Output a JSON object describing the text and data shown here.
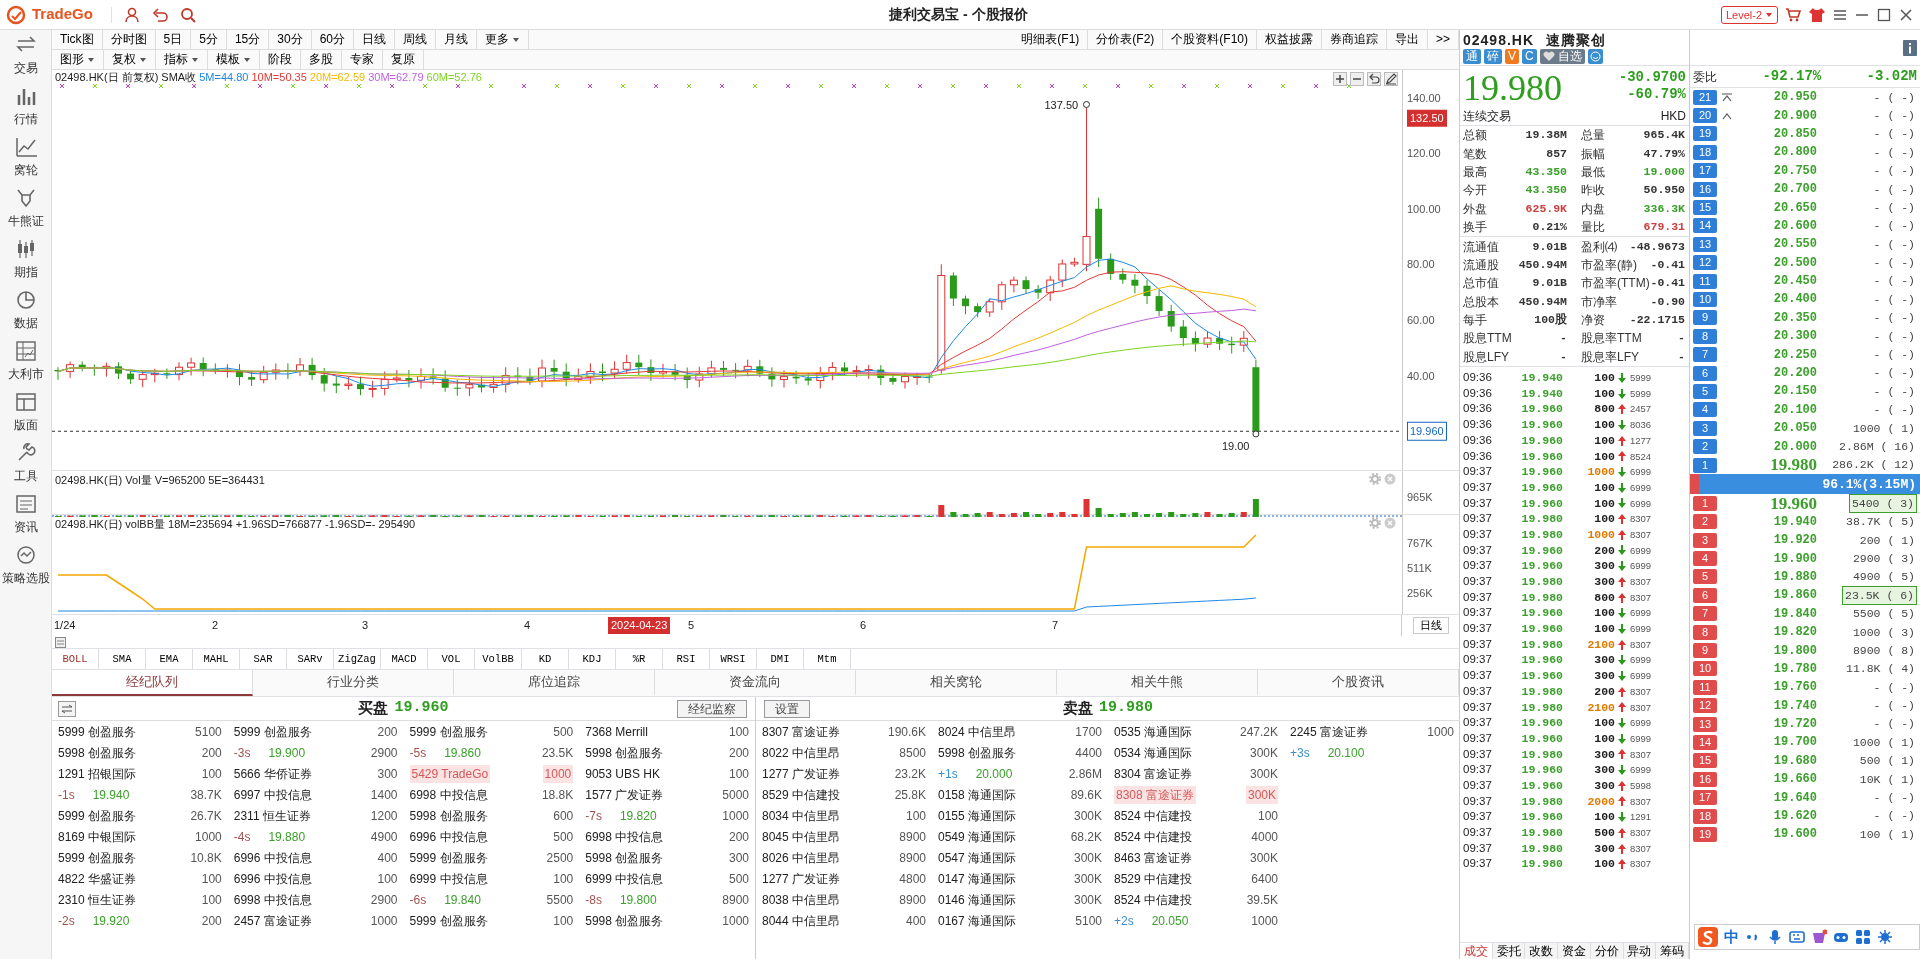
{
  "app": {
    "logo": "TradeGo",
    "title": "捷利交易宝 - 个股报价",
    "level_badge": "Level-2"
  },
  "sidebar": [
    {
      "label": "交易"
    },
    {
      "label": "行情"
    },
    {
      "label": "窝轮"
    },
    {
      "label": "牛熊证"
    },
    {
      "label": "期指"
    },
    {
      "label": "数据"
    },
    {
      "label": "大利市"
    },
    {
      "label": "版面"
    },
    {
      "label": "工具"
    },
    {
      "label": "资讯"
    },
    {
      "label": "策略选股"
    }
  ],
  "period_tabs": [
    {
      "label": "Tick图",
      "dropdown": false
    },
    {
      "label": "分时图",
      "dropdown": false
    },
    {
      "label": "5日",
      "dropdown": false
    },
    {
      "label": "5分",
      "dropdown": false
    },
    {
      "label": "15分",
      "dropdown": false
    },
    {
      "label": "30分",
      "dropdown": false
    },
    {
      "label": "60分",
      "dropdown": false
    },
    {
      "label": "日线",
      "dropdown": false
    },
    {
      "label": "周线",
      "dropdown": false
    },
    {
      "label": "月线",
      "dropdown": false
    },
    {
      "label": "更多",
      "dropdown": true
    }
  ],
  "view_buttons": [
    "明细表(F1)",
    "分价表(F2)",
    "个股资料(F10)",
    "权益披露",
    "券商追踪",
    "导出",
    ">>"
  ],
  "chart_toolbar": [
    {
      "label": "图形",
      "dropdown": true
    },
    {
      "label": "复权",
      "dropdown": true
    },
    {
      "label": "指标",
      "dropdown": true
    },
    {
      "label": "模板",
      "dropdown": true
    },
    {
      "label": "阶段",
      "dropdown": false
    },
    {
      "label": "多股",
      "dropdown": false
    },
    {
      "label": "专家",
      "dropdown": false
    },
    {
      "label": "复原",
      "dropdown": false
    }
  ],
  "main_chart": {
    "legend": "02498.HK(日 前复权) SMA收",
    "ma": [
      {
        "label": "5M=44.80",
        "color": "#1e88e5"
      },
      {
        "label": "10M=50.35",
        "color": "#e53935"
      },
      {
        "label": "20M=62.59",
        "color": "#f5b800"
      },
      {
        "label": "30M=62.79",
        "color": "#c060e0"
      },
      {
        "label": "60M=52.76",
        "color": "#7ed321"
      }
    ],
    "y_labels": [
      "140.00",
      "120.00",
      "100.00",
      "80.00",
      "60.00",
      "40.00"
    ],
    "crosshair_tag": "132.50",
    "last_price_tag": "19.960",
    "high_label": "137.50",
    "low_label": "19.00"
  },
  "volume_panel": {
    "legend": "02498.HK(日) Vol量 V=965200 5E=364431",
    "y_label": "965K"
  },
  "volbb_panel": {
    "legend": "02498.HK(日) volBB量 18M=235694 +1.96SD=766877 -1.96SD=- 295490",
    "y_labels": [
      "767K",
      "511K",
      "256K"
    ],
    "x_labels": [
      "1/24",
      "2",
      "3",
      "4",
      "5",
      "6",
      "7"
    ],
    "date_tag": "2024-04-23",
    "period_button": "日线"
  },
  "indicator_tabs": [
    {
      "label": "BOLL",
      "selected": true
    },
    {
      "label": "SMA",
      "selected": false
    },
    {
      "label": "EMA",
      "selected": false
    },
    {
      "label": "MAHL",
      "selected": false
    },
    {
      "label": "SAR",
      "selected": false
    },
    {
      "label": "SARv",
      "selected": false
    },
    {
      "label": "ZigZag",
      "selected": false
    },
    {
      "label": "MACD",
      "selected": false
    },
    {
      "label": "VOL",
      "selected": false
    },
    {
      "label": "VolBB",
      "selected": false
    },
    {
      "label": "KD",
      "selected": false
    },
    {
      "label": "KDJ",
      "selected": false
    },
    {
      "label": "%R",
      "selected": false
    },
    {
      "label": "RSI",
      "selected": false
    },
    {
      "label": "WRSI",
      "selected": false
    },
    {
      "label": "DMI",
      "selected": false
    },
    {
      "label": "Mtm",
      "selected": false
    }
  ],
  "broker_tabs": [
    {
      "label": "经纪队列",
      "selected": true
    },
    {
      "label": "行业分类",
      "selected": false
    },
    {
      "label": "席位追踪",
      "selected": false
    },
    {
      "label": "资金流向",
      "selected": false
    },
    {
      "label": "相关窝轮",
      "selected": false
    },
    {
      "label": "相关牛熊",
      "selected": false
    },
    {
      "label": "个股资讯",
      "selected": false
    }
  ],
  "bid_side": {
    "label": "买盘",
    "price": "19.960",
    "button": "经纪监察",
    "rows": [
      [
        {
          "kind": "broker",
          "code": "5999",
          "name": "创盈服务",
          "qty": "5100"
        },
        {
          "kind": "broker",
          "code": "5999",
          "name": "创盈服务",
          "qty": "200"
        },
        {
          "kind": "broker",
          "code": "5999",
          "name": "创盈服务",
          "qty": "500"
        },
        {
          "kind": "broker",
          "code": "7368",
          "name": "Merrill",
          "qty": "100"
        }
      ],
      [
        {
          "kind": "broker",
          "code": "5998",
          "name": "创盈服务",
          "qty": "200"
        },
        {
          "kind": "level",
          "time": "-3s",
          "price": "19.900",
          "qty": "2900"
        },
        {
          "kind": "level",
          "time": "-5s",
          "price": "19.860",
          "qty": "23.5K"
        },
        {
          "kind": "broker",
          "code": "5998",
          "name": "创盈服务",
          "qty": "200"
        }
      ],
      [
        {
          "kind": "broker",
          "code": "1291",
          "name": "招银国际",
          "qty": "100"
        },
        {
          "kind": "broker",
          "code": "5666",
          "name": "华侨证券",
          "qty": "300"
        },
        {
          "kind": "own",
          "code": "5429",
          "name": "TradeGo",
          "qty": "1000"
        },
        {
          "kind": "broker",
          "code": "9053",
          "name": "UBS HK",
          "qty": "100"
        }
      ],
      [
        {
          "kind": "level",
          "time": "-1s",
          "price": "19.940",
          "qty": "38.7K"
        },
        {
          "kind": "broker",
          "code": "6997",
          "name": "中投信息",
          "qty": "1400"
        },
        {
          "kind": "broker",
          "code": "6998",
          "name": "中投信息",
          "qty": "18.8K"
        },
        {
          "kind": "broker",
          "code": "1577",
          "name": "广发证券",
          "qty": "5000"
        }
      ],
      [
        {
          "kind": "broker",
          "code": "5999",
          "name": "创盈服务",
          "qty": "26.7K"
        },
        {
          "kind": "broker",
          "code": "2311",
          "name": "恒生证券",
          "qty": "1200"
        },
        {
          "kind": "broker",
          "code": "5998",
          "name": "创盈服务",
          "qty": "600"
        },
        {
          "kind": "level",
          "time": "-7s",
          "price": "19.820",
          "qty": "1000"
        }
      ],
      [
        {
          "kind": "broker",
          "code": "8169",
          "name": "中银国际",
          "qty": "1000"
        },
        {
          "kind": "level",
          "time": "-4s",
          "price": "19.880",
          "qty": "4900"
        },
        {
          "kind": "broker",
          "code": "6996",
          "name": "中投信息",
          "qty": "500"
        },
        {
          "kind": "broker",
          "code": "6998",
          "name": "中投信息",
          "qty": "200"
        }
      ],
      [
        {
          "kind": "broker",
          "code": "5999",
          "name": "创盈服务",
          "qty": "10.8K"
        },
        {
          "kind": "broker",
          "code": "6996",
          "name": "中投信息",
          "qty": "400"
        },
        {
          "kind": "broker",
          "code": "5999",
          "name": "创盈服务",
          "qty": "2500"
        },
        {
          "kind": "broker",
          "code": "5998",
          "name": "创盈服务",
          "qty": "300"
        }
      ],
      [
        {
          "kind": "broker",
          "code": "4822",
          "name": "华盛证券",
          "qty": "100"
        },
        {
          "kind": "broker",
          "code": "6996",
          "name": "中投信息",
          "qty": "100"
        },
        {
          "kind": "broker",
          "code": "6999",
          "name": "中投信息",
          "qty": "100"
        },
        {
          "kind": "broker",
          "code": "6999",
          "name": "中投信息",
          "qty": "500"
        }
      ],
      [
        {
          "kind": "broker",
          "code": "2310",
          "name": "恒生证券",
          "qty": "100"
        },
        {
          "kind": "broker",
          "code": "6998",
          "name": "中投信息",
          "qty": "2900"
        },
        {
          "kind": "level",
          "time": "-6s",
          "price": "19.840",
          "qty": "5500"
        },
        {
          "kind": "level",
          "time": "-8s",
          "price": "19.800",
          "qty": "8900"
        }
      ],
      [
        {
          "kind": "level",
          "time": "-2s",
          "price": "19.920",
          "qty": "200"
        },
        {
          "kind": "broker",
          "code": "2457",
          "name": "富途证券",
          "qty": "1000"
        },
        {
          "kind": "broker",
          "code": "5999",
          "name": "创盈服务",
          "qty": "100"
        },
        {
          "kind": "broker",
          "code": "5998",
          "name": "创盈服务",
          "qty": "1000"
        }
      ]
    ]
  },
  "ask_side": {
    "label": "卖盘",
    "price": "19.980",
    "button": "设置",
    "rows": [
      [
        {
          "kind": "broker",
          "code": "8307",
          "name": "富途证券",
          "qty": "190.6K"
        },
        {
          "kind": "broker",
          "code": "8024",
          "name": "中信里昂",
          "qty": "1700"
        },
        {
          "kind": "broker",
          "code": "0535",
          "name": "海通国际",
          "qty": "247.2K"
        },
        {
          "kind": "broker",
          "code": "2245",
          "name": "富途证券",
          "qty": "1000"
        }
      ],
      [
        {
          "kind": "broker",
          "code": "8022",
          "name": "中信里昂",
          "qty": "8500"
        },
        {
          "kind": "broker",
          "code": "5998",
          "name": "创盈服务",
          "qty": "4400"
        },
        {
          "kind": "broker",
          "code": "0534",
          "name": "海通国际",
          "qty": "300K"
        },
        {
          "kind": "level",
          "time": "+3s",
          "price": "20.100"
        }
      ],
      [
        {
          "kind": "broker",
          "code": "1277",
          "name": "广发证券",
          "qty": "23.2K"
        },
        {
          "kind": "level",
          "time": "+1s",
          "price": "20.000",
          "qty": "2.86M"
        },
        {
          "kind": "broker",
          "code": "8304",
          "name": "富途证券",
          "qty": "300K"
        }
      ],
      [
        {
          "kind": "broker",
          "code": "8529",
          "name": "中信建投",
          "qty": "25.8K"
        },
        {
          "kind": "broker",
          "code": "0158",
          "name": "海通国际",
          "qty": "89.6K"
        },
        {
          "kind": "own",
          "code": "8308",
          "name": "富途证券",
          "qty": "300K"
        }
      ],
      [
        {
          "kind": "broker",
          "code": "8034",
          "name": "中信里昂",
          "qty": "100"
        },
        {
          "kind": "broker",
          "code": "0155",
          "name": "海通国际",
          "qty": "300K"
        },
        {
          "kind": "broker",
          "code": "8524",
          "name": "中信建投",
          "qty": "100"
        }
      ],
      [
        {
          "kind": "broker",
          "code": "8045",
          "name": "中信里昂",
          "qty": "8900"
        },
        {
          "kind": "broker",
          "code": "0549",
          "name": "海通国际",
          "qty": "68.2K"
        },
        {
          "kind": "broker",
          "code": "8524",
          "name": "中信建投",
          "qty": "4000"
        }
      ],
      [
        {
          "kind": "broker",
          "code": "8026",
          "name": "中信里昂",
          "qty": "8900"
        },
        {
          "kind": "broker",
          "code": "0547",
          "name": "海通国际",
          "qty": "300K"
        },
        {
          "kind": "broker",
          "code": "8463",
          "name": "富途证券",
          "qty": "300K"
        }
      ],
      [
        {
          "kind": "broker",
          "code": "1277",
          "name": "广发证券",
          "qty": "4800"
        },
        {
          "kind": "broker",
          "code": "0147",
          "name": "海通国际",
          "qty": "300K"
        },
        {
          "kind": "broker",
          "code": "8529",
          "name": "中信建投",
          "qty": "6400"
        }
      ],
      [
        {
          "kind": "broker",
          "code": "8038",
          "name": "中信里昂",
          "qty": "8900"
        },
        {
          "kind": "broker",
          "code": "0146",
          "name": "海通国际",
          "qty": "300K"
        },
        {
          "kind": "broker",
          "code": "8524",
          "name": "中信建投",
          "qty": "39.5K"
        }
      ],
      [
        {
          "kind": "broker",
          "code": "8044",
          "name": "中信里昂",
          "qty": "400"
        },
        {
          "kind": "broker",
          "code": "0167",
          "name": "海通国际",
          "qty": "5100"
        },
        {
          "kind": "level",
          "time": "+2s",
          "price": "20.050",
          "qty": "1000"
        }
      ]
    ]
  },
  "quote": {
    "code": "02498.HK",
    "name": "速腾聚创",
    "tags": [
      "通",
      "碎",
      "V",
      "C"
    ],
    "watch": "自选",
    "price": "19.980",
    "change": "-30.9700",
    "change_pct": "-60.79%",
    "status": "连续交易",
    "currency": "HKD",
    "stats": [
      {
        "label": "总额",
        "value": "19.38M",
        "color": "#333333"
      },
      {
        "label": "总量",
        "value": "965.4K",
        "color": "#333333"
      },
      {
        "label": "笔数",
        "value": "857",
        "color": "#333333"
      },
      {
        "label": "振幅",
        "value": "47.79%",
        "color": "#333333"
      },
      {
        "label": "最高",
        "value": "43.350",
        "color": "#3aa02a"
      },
      {
        "label": "最低",
        "value": "19.000",
        "color": "#3aa02a"
      },
      {
        "label": "今开",
        "value": "43.350",
        "color": "#3aa02a"
      },
      {
        "label": "昨收",
        "value": "50.950",
        "color": "#333333"
      },
      {
        "label": "外盘",
        "value": "625.9K",
        "color": "#c94040"
      },
      {
        "label": "内盘",
        "value": "336.3K",
        "color": "#3aa02a"
      },
      {
        "label": "换手",
        "value": "0.21%",
        "color": "#333333"
      },
      {
        "label": "量比",
        "value": "679.31",
        "color": "#c94040"
      }
    ],
    "fundamentals": [
      {
        "label": "流通值",
        "value": "9.01B"
      },
      {
        "label": "盈利⑷",
        "value": "-48.9673"
      },
      {
        "label": "流通股",
        "value": "450.94M"
      },
      {
        "label": "市盈率(静)",
        "value": "-0.41"
      },
      {
        "label": "总市值",
        "value": "9.01B"
      },
      {
        "label": "市盈率(TTM)",
        "value": "-0.41"
      },
      {
        "label": "总股本",
        "value": "450.94M"
      },
      {
        "label": "市净率",
        "value": "-0.90"
      },
      {
        "label": "每手",
        "value": "100股"
      },
      {
        "label": "净资",
        "value": "-22.1715"
      },
      {
        "label": "股息TTM",
        "value": "-"
      },
      {
        "label": "股息率TTM",
        "value": "-"
      },
      {
        "label": "股息LFY",
        "value": "-"
      },
      {
        "label": "股息率LFY",
        "value": "-"
      }
    ]
  },
  "ticks": [
    {
      "time": "09:36",
      "price": "19.940",
      "volume": "100",
      "large": false,
      "buy": false,
      "broker": "5999"
    },
    {
      "time": "09:36",
      "price": "19.940",
      "volume": "100",
      "large": false,
      "buy": false,
      "broker": "5999"
    },
    {
      "time": "09:36",
      "price": "19.960",
      "volume": "800",
      "large": false,
      "buy": true,
      "broker": "2457"
    },
    {
      "time": "09:36",
      "price": "19.960",
      "volume": "100",
      "large": false,
      "buy": false,
      "broker": "8036"
    },
    {
      "time": "09:36",
      "price": "19.960",
      "volume": "100",
      "large": false,
      "buy": true,
      "broker": "1277"
    },
    {
      "time": "09:36",
      "price": "19.960",
      "volume": "100",
      "large": false,
      "buy": true,
      "broker": "8524"
    },
    {
      "time": "09:37",
      "price": "19.960",
      "volume": "1000",
      "large": true,
      "buy": false,
      "broker": "6999"
    },
    {
      "time": "09:37",
      "price": "19.960",
      "volume": "100",
      "large": false,
      "buy": false,
      "broker": "6999"
    },
    {
      "time": "09:37",
      "price": "19.960",
      "volume": "100",
      "large": false,
      "buy": false,
      "broker": "6999"
    },
    {
      "time": "09:37",
      "price": "19.980",
      "volume": "100",
      "large": false,
      "buy": true,
      "broker": "8307"
    },
    {
      "time": "09:37",
      "price": "19.980",
      "volume": "1000",
      "large": true,
      "buy": true,
      "broker": "8307"
    },
    {
      "time": "09:37",
      "price": "19.960",
      "volume": "200",
      "large": false,
      "buy": false,
      "broker": "6999"
    },
    {
      "time": "09:37",
      "price": "19.960",
      "volume": "300",
      "large": false,
      "buy": false,
      "broker": "6999"
    },
    {
      "time": "09:37",
      "price": "19.980",
      "volume": "300",
      "large": false,
      "buy": true,
      "broker": "8307"
    },
    {
      "time": "09:37",
      "price": "19.980",
      "volume": "800",
      "large": false,
      "buy": true,
      "broker": "8307"
    },
    {
      "time": "09:37",
      "price": "19.960",
      "volume": "100",
      "large": false,
      "buy": false,
      "broker": "6999"
    },
    {
      "time": "09:37",
      "price": "19.960",
      "volume": "100",
      "large": false,
      "buy": false,
      "broker": "6999"
    },
    {
      "time": "09:37",
      "price": "19.980",
      "volume": "2100",
      "large": true,
      "buy": true,
      "broker": "8307"
    },
    {
      "time": "09:37",
      "price": "19.960",
      "volume": "300",
      "large": false,
      "buy": false,
      "broker": "6999"
    },
    {
      "time": "09:37",
      "price": "19.960",
      "volume": "300",
      "large": false,
      "buy": false,
      "broker": "6999"
    },
    {
      "time": "09:37",
      "price": "19.980",
      "volume": "200",
      "large": false,
      "buy": true,
      "broker": "8307"
    },
    {
      "time": "09:37",
      "price": "19.980",
      "volume": "2100",
      "large": true,
      "buy": true,
      "broker": "8307"
    },
    {
      "time": "09:37",
      "price": "19.960",
      "volume": "100",
      "large": false,
      "buy": false,
      "broker": "6999"
    },
    {
      "time": "09:37",
      "price": "19.960",
      "volume": "100",
      "large": false,
      "buy": false,
      "broker": "6999"
    },
    {
      "time": "09:37",
      "price": "19.980",
      "volume": "300",
      "large": false,
      "buy": true,
      "broker": "8307"
    },
    {
      "time": "09:37",
      "price": "19.960",
      "volume": "300",
      "large": false,
      "buy": false,
      "broker": "6999"
    },
    {
      "time": "09:37",
      "price": "19.960",
      "volume": "300",
      "large": false,
      "buy": true,
      "broker": "5998"
    },
    {
      "time": "09:37",
      "price": "19.980",
      "volume": "2000",
      "large": true,
      "buy": true,
      "broker": "8307"
    },
    {
      "time": "09:37",
      "price": "19.960",
      "volume": "100",
      "large": false,
      "buy": false,
      "broker": "1291"
    },
    {
      "time": "09:37",
      "price": "19.980",
      "volume": "500",
      "large": false,
      "buy": true,
      "broker": "8307"
    },
    {
      "time": "09:37",
      "price": "19.980",
      "volume": "300",
      "large": false,
      "buy": true,
      "broker": "8307"
    },
    {
      "time": "09:37",
      "price": "19.980",
      "volume": "100",
      "large": false,
      "buy": true,
      "broker": "8307"
    }
  ],
  "bottom_tabs": [
    {
      "label": "成交",
      "selected": true
    },
    {
      "label": "委托",
      "selected": false
    },
    {
      "label": "改数",
      "selected": false
    },
    {
      "label": "资金",
      "selected": false
    },
    {
      "label": "分价",
      "selected": false
    },
    {
      "label": "异动",
      "selected": false
    },
    {
      "label": "筹码",
      "selected": false
    }
  ],
  "order_book": {
    "ratio_label": "委比",
    "ratio": "-92.17%",
    "diff": "-3.02M",
    "asks": [
      {
        "level": "21",
        "price": "20.950",
        "depth": "- ( -)"
      },
      {
        "level": "20",
        "price": "20.900",
        "depth": "- ( -)"
      },
      {
        "level": "19",
        "price": "20.850",
        "depth": "- ( -)"
      },
      {
        "level": "18",
        "price": "20.800",
        "depth": "- ( -)"
      },
      {
        "level": "17",
        "price": "20.750",
        "depth": "- ( -)"
      },
      {
        "level": "16",
        "price": "20.700",
        "depth": "- ( -)"
      },
      {
        "level": "15",
        "price": "20.650",
        "depth": "- ( -)"
      },
      {
        "level": "14",
        "price": "20.600",
        "depth": "- ( -)"
      },
      {
        "level": "13",
        "price": "20.550",
        "depth": "- ( -)"
      },
      {
        "level": "12",
        "price": "20.500",
        "depth": "- ( -)"
      },
      {
        "level": "11",
        "price": "20.450",
        "depth": "- ( -)"
      },
      {
        "level": "10",
        "price": "20.400",
        "depth": "- ( -)"
      },
      {
        "level": "9",
        "price": "20.350",
        "depth": "- ( -)"
      },
      {
        "level": "8",
        "price": "20.300",
        "depth": "- ( -)"
      },
      {
        "level": "7",
        "price": "20.250",
        "depth": "- ( -)"
      },
      {
        "level": "6",
        "price": "20.200",
        "depth": "- ( -)"
      },
      {
        "level": "5",
        "price": "20.150",
        "depth": "- ( -)"
      },
      {
        "level": "4",
        "price": "20.100",
        "depth": "- ( -)"
      },
      {
        "level": "3",
        "price": "20.050",
        "depth": "1000 ( 1)"
      },
      {
        "level": "2",
        "price": "20.000",
        "depth": "2.86M ( 16)"
      },
      {
        "level": "1",
        "price": "19.980",
        "depth": "286.2K ( 12)"
      }
    ],
    "balance": {
      "label": "96.1%(3.15M)",
      "level": 0.961
    },
    "bids": [
      {
        "level": "1",
        "price": "19.960",
        "depth": "5400 ( 3)",
        "boxed": true
      },
      {
        "level": "2",
        "price": "19.940",
        "depth": "38.7K ( 5)",
        "boxed": false
      },
      {
        "level": "3",
        "price": "19.920",
        "depth": "200 ( 1)",
        "boxed": false
      },
      {
        "level": "4",
        "price": "19.900",
        "depth": "2900 ( 3)",
        "boxed": false
      },
      {
        "level": "5",
        "price": "19.880",
        "depth": "4900 ( 5)",
        "boxed": false
      },
      {
        "level": "6",
        "price": "19.860",
        "depth": "23.5K ( 6)",
        "boxed": true
      },
      {
        "level": "7",
        "price": "19.840",
        "depth": "5500 ( 5)",
        "boxed": false
      },
      {
        "level": "8",
        "price": "19.820",
        "depth": "1000 ( 3)",
        "boxed": false
      },
      {
        "level": "9",
        "price": "19.800",
        "depth": "8900 ( 8)",
        "boxed": false
      },
      {
        "level": "10",
        "price": "19.780",
        "depth": "11.8K ( 4)",
        "boxed": false
      },
      {
        "level": "11",
        "price": "19.760",
        "depth": "- ( -)",
        "boxed": false
      },
      {
        "level": "12",
        "price": "19.740",
        "depth": "- ( -)",
        "boxed": false
      },
      {
        "level": "13",
        "price": "19.720",
        "depth": "- ( -)",
        "boxed": false
      },
      {
        "level": "14",
        "price": "19.700",
        "depth": "1000 ( 1)",
        "boxed": false
      },
      {
        "level": "15",
        "price": "19.680",
        "depth": "500 ( 1)",
        "boxed": false
      },
      {
        "level": "16",
        "price": "19.660",
        "depth": "10K ( 1)",
        "boxed": false
      },
      {
        "level": "17",
        "price": "19.640",
        "depth": "- ( -)",
        "boxed": false
      },
      {
        "level": "18",
        "price": "19.620",
        "depth": "- ( -)",
        "boxed": false
      },
      {
        "level": "19",
        "price": "19.600",
        "depth": "100 ( 1)",
        "boxed": false
      }
    ]
  },
  "ime_bar": {
    "mode": "中"
  }
}
